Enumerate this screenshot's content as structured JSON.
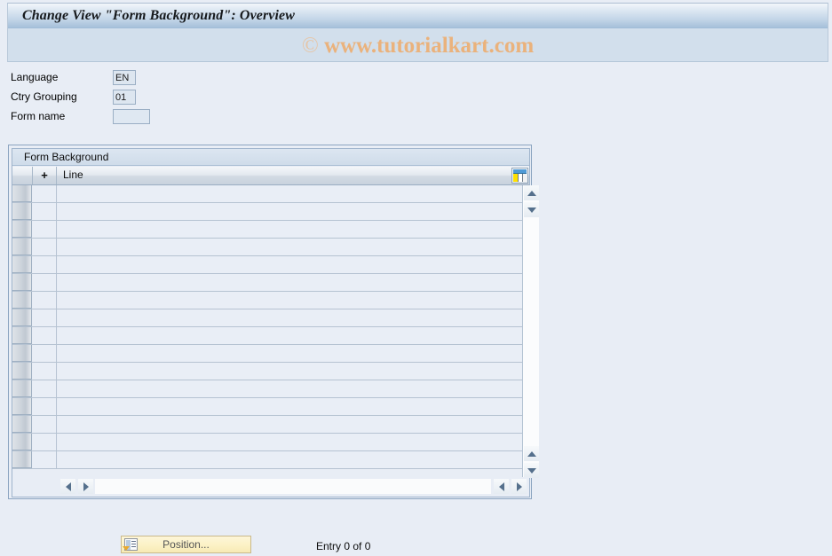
{
  "window": {
    "title": "Change View \"Form Background\": Overview"
  },
  "watermark": {
    "copyright_symbol": "©",
    "text": "www.tutorialkart.com"
  },
  "fields": [
    {
      "label": "Language",
      "value": "EN",
      "readonly": true,
      "name": "language"
    },
    {
      "label": "Ctry Grouping",
      "value": "01",
      "readonly": true,
      "name": "ctry-grouping"
    },
    {
      "label": "Form name",
      "value": "",
      "readonly": false,
      "name": "form-name"
    }
  ],
  "table": {
    "caption": "Form Background",
    "columns": [
      {
        "label": "",
        "name": "select"
      },
      {
        "label": "+",
        "name": "expand"
      },
      {
        "label": "Line",
        "name": "line"
      }
    ],
    "config_icon": "table-settings-icon",
    "row_count": 16,
    "rows": []
  },
  "scrollbars": {
    "vertical": {
      "up_icon": "scroll-up-icon",
      "down_icon": "scroll-down-icon"
    },
    "horizontal": {
      "left_icon": "scroll-left-icon",
      "right_icon": "scroll-right-icon"
    }
  },
  "footer": {
    "position_button": "Position...",
    "position_icon": "position-icon",
    "entry_status": "Entry 0 of 0"
  },
  "colors": {
    "page_background": "#e8edf5",
    "titlebar_top": "#f2f6fb",
    "titlebar_bottom": "#a6c0da",
    "subband": "#d2dfec",
    "watermark": "#eab27c",
    "panel_border": "#8ba4c0",
    "grid_cell": "#e9eef6",
    "grid_line": "#b6c3d2",
    "button_face": "#fcf2c7"
  }
}
